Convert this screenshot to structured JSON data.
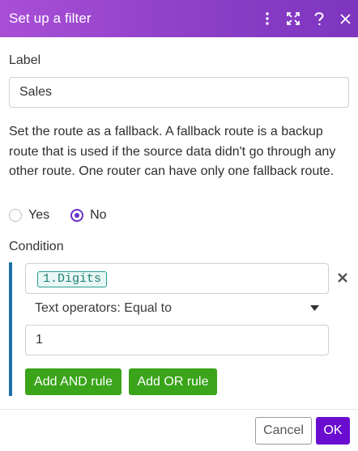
{
  "dialog": {
    "title": "Set up a filter",
    "header_icons": [
      "more-vertical-icon",
      "expand-icon",
      "help-icon",
      "close-icon"
    ],
    "header_gradient": [
      "#a84fd6",
      "#7d35c0"
    ]
  },
  "label_section": {
    "heading": "Label",
    "value": "Sales"
  },
  "fallback": {
    "description": "Set the route as a fallback. A fallback route is a backup route that is used if the source data didn't go through any other route. One router can have only one fallback route.",
    "options": [
      {
        "label": "Yes",
        "checked": false
      },
      {
        "label": "No",
        "checked": true
      }
    ]
  },
  "condition": {
    "heading": "Condition",
    "rule": {
      "field_token": "1.Digits",
      "operator": "Text operators: Equal to",
      "value": "1"
    },
    "add_and_label": "Add AND rule",
    "add_or_label": "Add OR rule"
  },
  "footer": {
    "cancel_label": "Cancel",
    "ok_label": "OK"
  },
  "colors": {
    "accent": "#6a0dd1",
    "green": "#3aa41a",
    "condition_bar": "#1e6fa8",
    "token": "#1d7f73"
  }
}
